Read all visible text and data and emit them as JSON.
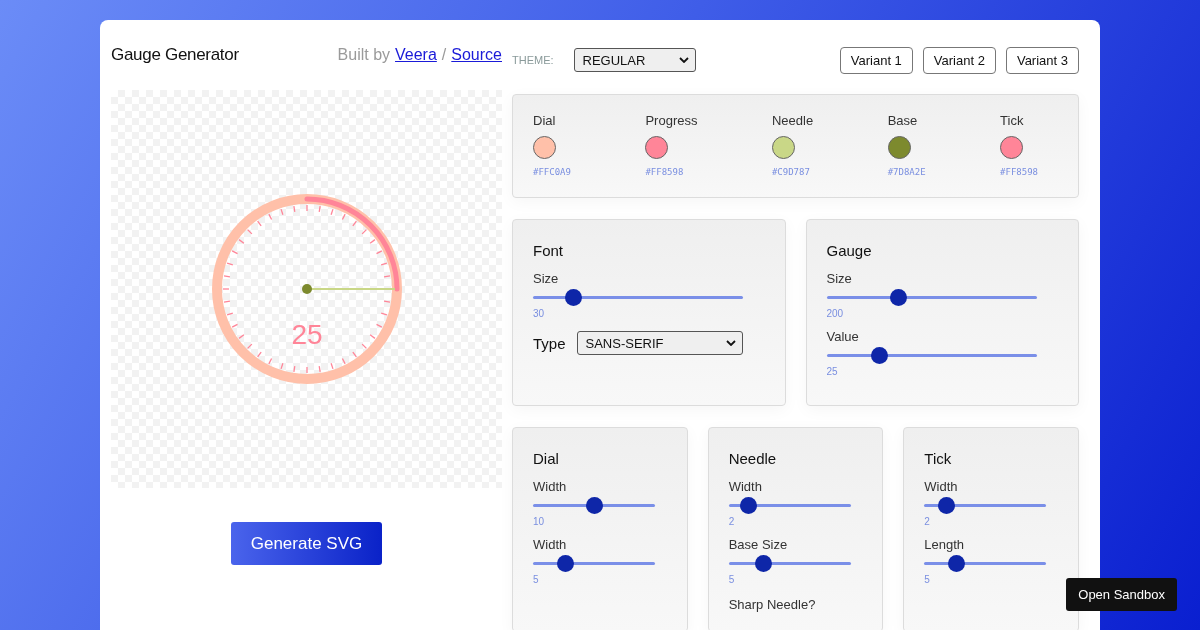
{
  "header": {
    "title": "Gauge Generator",
    "credit_prefix": "Built by",
    "author_link": "Veera",
    "separator": "/",
    "source_link": "Source"
  },
  "preview": {
    "value_text": "25"
  },
  "generate_button": "Generate SVG",
  "theme": {
    "label": "THEME:",
    "value": "REGULAR"
  },
  "variants": [
    "Variant 1",
    "Variant 2",
    "Variant 3"
  ],
  "palette": [
    {
      "name": "Dial",
      "hex": "#FFC0A9",
      "color": "#ffc0a9"
    },
    {
      "name": "Progress",
      "hex": "#FF8598",
      "color": "#ff8598"
    },
    {
      "name": "Needle",
      "hex": "#C9D787",
      "color": "#c9d787"
    },
    {
      "name": "Base",
      "hex": "#7D8A2E",
      "color": "#7d8a2e"
    },
    {
      "name": "Tick",
      "hex": "#FF8598",
      "color": "#ff8598"
    }
  ],
  "panels": [
    {
      "title": "Font",
      "controls": [
        {
          "kind": "slider",
          "label": "Size",
          "level": 0.19,
          "reading": "30"
        },
        {
          "kind": "select",
          "label": "Type",
          "value": "SANS-SERIF"
        }
      ]
    },
    {
      "title": "Gauge",
      "controls": [
        {
          "kind": "slider",
          "label": "Size",
          "level": 0.34,
          "reading": "200"
        },
        {
          "kind": "slider",
          "label": "Value",
          "level": 0.25,
          "reading": "25"
        }
      ]
    }
  ],
  "bottom_panels": [
    {
      "title": "Dial",
      "controls": [
        {
          "kind": "slider",
          "label": "Width",
          "level": 0.5,
          "reading": "10"
        },
        {
          "kind": "slider",
          "label": "Width",
          "level": 0.26,
          "reading": "5"
        }
      ]
    },
    {
      "title": "Needle",
      "controls": [
        {
          "kind": "slider",
          "label": "Width",
          "level": 0.16,
          "reading": "2"
        },
        {
          "kind": "slider",
          "label": "Base Size",
          "level": 0.28,
          "reading": "5"
        },
        {
          "kind": "label",
          "label": "Sharp Needle?"
        }
      ]
    },
    {
      "title": "Tick",
      "controls": [
        {
          "kind": "slider",
          "label": "Width",
          "level": 0.18,
          "reading": "2"
        },
        {
          "kind": "slider",
          "label": "Length",
          "level": 0.26,
          "reading": "5"
        }
      ]
    }
  ],
  "sandbox_button": "Open Sandbox"
}
